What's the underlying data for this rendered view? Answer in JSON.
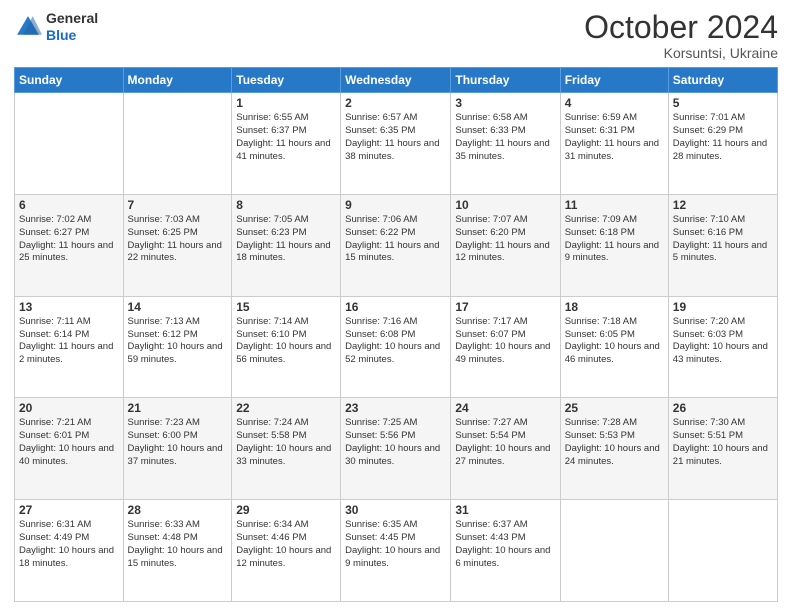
{
  "logo": {
    "general": "General",
    "blue": "Blue"
  },
  "header": {
    "month": "October 2024",
    "location": "Korsuntsi, Ukraine"
  },
  "weekdays": [
    "Sunday",
    "Monday",
    "Tuesday",
    "Wednesday",
    "Thursday",
    "Friday",
    "Saturday"
  ],
  "weeks": [
    [
      {
        "day": "",
        "info": ""
      },
      {
        "day": "",
        "info": ""
      },
      {
        "day": "1",
        "info": "Sunrise: 6:55 AM\nSunset: 6:37 PM\nDaylight: 11 hours and 41 minutes."
      },
      {
        "day": "2",
        "info": "Sunrise: 6:57 AM\nSunset: 6:35 PM\nDaylight: 11 hours and 38 minutes."
      },
      {
        "day": "3",
        "info": "Sunrise: 6:58 AM\nSunset: 6:33 PM\nDaylight: 11 hours and 35 minutes."
      },
      {
        "day": "4",
        "info": "Sunrise: 6:59 AM\nSunset: 6:31 PM\nDaylight: 11 hours and 31 minutes."
      },
      {
        "day": "5",
        "info": "Sunrise: 7:01 AM\nSunset: 6:29 PM\nDaylight: 11 hours and 28 minutes."
      }
    ],
    [
      {
        "day": "6",
        "info": "Sunrise: 7:02 AM\nSunset: 6:27 PM\nDaylight: 11 hours and 25 minutes."
      },
      {
        "day": "7",
        "info": "Sunrise: 7:03 AM\nSunset: 6:25 PM\nDaylight: 11 hours and 22 minutes."
      },
      {
        "day": "8",
        "info": "Sunrise: 7:05 AM\nSunset: 6:23 PM\nDaylight: 11 hours and 18 minutes."
      },
      {
        "day": "9",
        "info": "Sunrise: 7:06 AM\nSunset: 6:22 PM\nDaylight: 11 hours and 15 minutes."
      },
      {
        "day": "10",
        "info": "Sunrise: 7:07 AM\nSunset: 6:20 PM\nDaylight: 11 hours and 12 minutes."
      },
      {
        "day": "11",
        "info": "Sunrise: 7:09 AM\nSunset: 6:18 PM\nDaylight: 11 hours and 9 minutes."
      },
      {
        "day": "12",
        "info": "Sunrise: 7:10 AM\nSunset: 6:16 PM\nDaylight: 11 hours and 5 minutes."
      }
    ],
    [
      {
        "day": "13",
        "info": "Sunrise: 7:11 AM\nSunset: 6:14 PM\nDaylight: 11 hours and 2 minutes."
      },
      {
        "day": "14",
        "info": "Sunrise: 7:13 AM\nSunset: 6:12 PM\nDaylight: 10 hours and 59 minutes."
      },
      {
        "day": "15",
        "info": "Sunrise: 7:14 AM\nSunset: 6:10 PM\nDaylight: 10 hours and 56 minutes."
      },
      {
        "day": "16",
        "info": "Sunrise: 7:16 AM\nSunset: 6:08 PM\nDaylight: 10 hours and 52 minutes."
      },
      {
        "day": "17",
        "info": "Sunrise: 7:17 AM\nSunset: 6:07 PM\nDaylight: 10 hours and 49 minutes."
      },
      {
        "day": "18",
        "info": "Sunrise: 7:18 AM\nSunset: 6:05 PM\nDaylight: 10 hours and 46 minutes."
      },
      {
        "day": "19",
        "info": "Sunrise: 7:20 AM\nSunset: 6:03 PM\nDaylight: 10 hours and 43 minutes."
      }
    ],
    [
      {
        "day": "20",
        "info": "Sunrise: 7:21 AM\nSunset: 6:01 PM\nDaylight: 10 hours and 40 minutes."
      },
      {
        "day": "21",
        "info": "Sunrise: 7:23 AM\nSunset: 6:00 PM\nDaylight: 10 hours and 37 minutes."
      },
      {
        "day": "22",
        "info": "Sunrise: 7:24 AM\nSunset: 5:58 PM\nDaylight: 10 hours and 33 minutes."
      },
      {
        "day": "23",
        "info": "Sunrise: 7:25 AM\nSunset: 5:56 PM\nDaylight: 10 hours and 30 minutes."
      },
      {
        "day": "24",
        "info": "Sunrise: 7:27 AM\nSunset: 5:54 PM\nDaylight: 10 hours and 27 minutes."
      },
      {
        "day": "25",
        "info": "Sunrise: 7:28 AM\nSunset: 5:53 PM\nDaylight: 10 hours and 24 minutes."
      },
      {
        "day": "26",
        "info": "Sunrise: 7:30 AM\nSunset: 5:51 PM\nDaylight: 10 hours and 21 minutes."
      }
    ],
    [
      {
        "day": "27",
        "info": "Sunrise: 6:31 AM\nSunset: 4:49 PM\nDaylight: 10 hours and 18 minutes."
      },
      {
        "day": "28",
        "info": "Sunrise: 6:33 AM\nSunset: 4:48 PM\nDaylight: 10 hours and 15 minutes."
      },
      {
        "day": "29",
        "info": "Sunrise: 6:34 AM\nSunset: 4:46 PM\nDaylight: 10 hours and 12 minutes."
      },
      {
        "day": "30",
        "info": "Sunrise: 6:35 AM\nSunset: 4:45 PM\nDaylight: 10 hours and 9 minutes."
      },
      {
        "day": "31",
        "info": "Sunrise: 6:37 AM\nSunset: 4:43 PM\nDaylight: 10 hours and 6 minutes."
      },
      {
        "day": "",
        "info": ""
      },
      {
        "day": "",
        "info": ""
      }
    ]
  ]
}
